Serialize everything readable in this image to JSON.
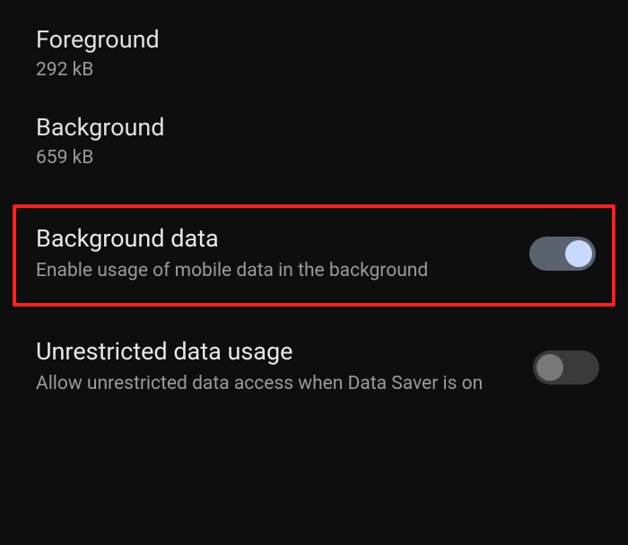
{
  "stats": {
    "foreground": {
      "label": "Foreground",
      "value": "292 kB"
    },
    "background": {
      "label": "Background",
      "value": "659 kB"
    }
  },
  "toggles": {
    "backgroundData": {
      "title": "Background data",
      "subtitle": "Enable usage of mobile data in the background",
      "enabled": true,
      "highlighted": true
    },
    "unrestrictedData": {
      "title": "Unrestricted data usage",
      "subtitle": "Allow unrestricted data access when Data Saver is on",
      "enabled": false,
      "highlighted": false
    }
  }
}
